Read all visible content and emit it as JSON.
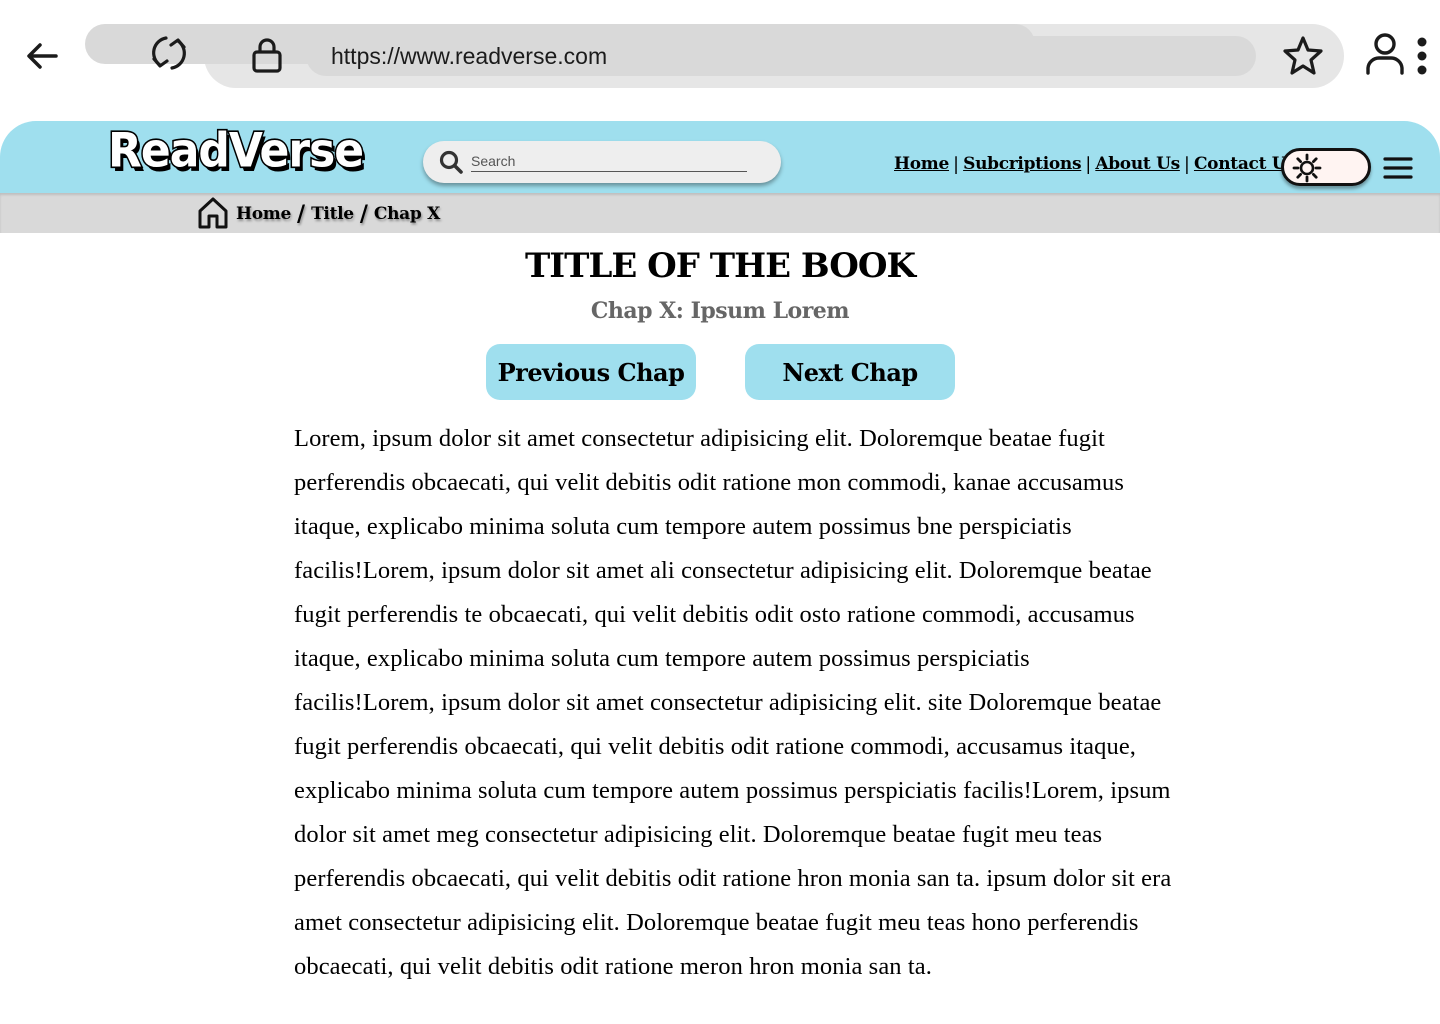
{
  "browser": {
    "url": "https://www.readverse.com",
    "icons": [
      "back-arrow-icon",
      "reload-icon",
      "lock-icon",
      "star-icon",
      "profile-icon",
      "more-dots-icon"
    ]
  },
  "header": {
    "logo": "ReadVerse",
    "search_placeholder": "Search",
    "nav": [
      "Home",
      "Subcriptions",
      "About Us",
      "Contact Us"
    ],
    "colors": {
      "accent": "#9fdfee",
      "crumb_bar": "#d9d9d9",
      "toggle_bg": "#fff4f2"
    }
  },
  "breadcrumb": {
    "items": [
      "Home",
      "Title",
      "Chap X"
    ],
    "separator": "/"
  },
  "book": {
    "title": "TITLE OF THE BOOK",
    "chapter": "Chap X: Ipsum Lorem",
    "prev_label": "Previous Chap",
    "next_label": "Next Chap",
    "text": "Lorem, ipsum dolor sit amet consectetur adipisicing elit. Doloremque beatae fugit perferendis obcaecati, qui velit debitis odit ratione mon commodi, kanae accusamus itaque, explicabo minima soluta cum tempore autem possimus bne perspiciatis facilis!Lorem, ipsum dolor sit amet ali consectetur adipisicing elit. Doloremque beatae fugit perferendis te obcaecati, qui velit debitis odit osto ratione commodi, accusamus itaque, explicabo minima soluta cum tempore autem possimus perspiciatis facilis!Lorem, ipsum dolor sit amet consectetur adipisicing elit. site Doloremque beatae fugit perferendis obcaecati, qui velit debitis odit ratione commodi, accusamus itaque, explicabo minima soluta cum tempore autem possimus perspiciatis facilis!Lorem, ipsum dolor sit amet meg consectetur adipisicing elit. Doloremque beatae fugit meu teas perferendis obcaecati, qui velit debitis odit ratione hron monia san ta. ipsum dolor sit era amet consectetur adipisicing elit. Doloremque beatae fugit meu teas hono perferendis obcaecati, qui velit debitis odit ratione meron hron monia san ta."
  }
}
